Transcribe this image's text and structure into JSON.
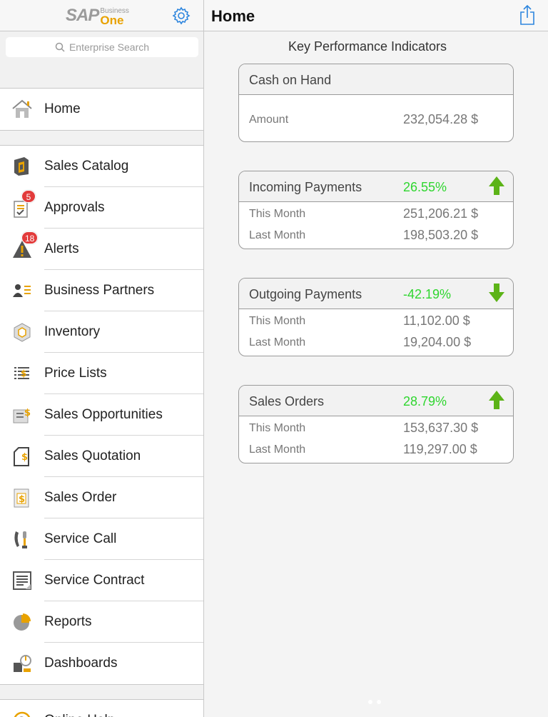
{
  "brand": {
    "sap": "SAP",
    "business": "Business",
    "one": "One"
  },
  "search": {
    "placeholder": "Enterprise Search"
  },
  "sidebar": {
    "home": {
      "label": "Home"
    },
    "items": [
      {
        "label": "Sales Catalog"
      },
      {
        "label": "Approvals",
        "badge": "5"
      },
      {
        "label": "Alerts",
        "badge": "18"
      },
      {
        "label": "Business Partners"
      },
      {
        "label": "Inventory"
      },
      {
        "label": "Price Lists"
      },
      {
        "label": "Sales Opportunities"
      },
      {
        "label": "Sales Quotation"
      },
      {
        "label": "Sales Order"
      },
      {
        "label": "Service Call"
      },
      {
        "label": "Service Contract"
      },
      {
        "label": "Reports"
      },
      {
        "label": "Dashboards"
      }
    ],
    "help": {
      "label": "Online Help"
    }
  },
  "header": {
    "title": "Home"
  },
  "kpi": {
    "title": "Key Performance Indicators",
    "cash": {
      "name": "Cash on Hand",
      "amount_label": "Amount",
      "amount": "232,054.28 $"
    },
    "cards": [
      {
        "name": "Incoming Payments",
        "pct": "26.55%",
        "trend": "up",
        "this_label": "This Month",
        "this": "251,206.21 $",
        "last_label": "Last Month",
        "last": "198,503.20 $"
      },
      {
        "name": "Outgoing Payments",
        "pct": "-42.19%",
        "trend": "down",
        "this_label": "This Month",
        "this": "11,102.00 $",
        "last_label": "Last Month",
        "last": "19,204.00 $"
      },
      {
        "name": "Sales Orders",
        "pct": "28.79%",
        "trend": "up",
        "this_label": "This Month",
        "this": "153,637.30 $",
        "last_label": "Last Month",
        "last": "119,297.00 $"
      }
    ]
  },
  "colors": {
    "accent": "#2e86de",
    "up": "#2fd62f",
    "arrow": "#5cb317",
    "badge": "#e23b3b",
    "brand_one": "#e8a200"
  }
}
